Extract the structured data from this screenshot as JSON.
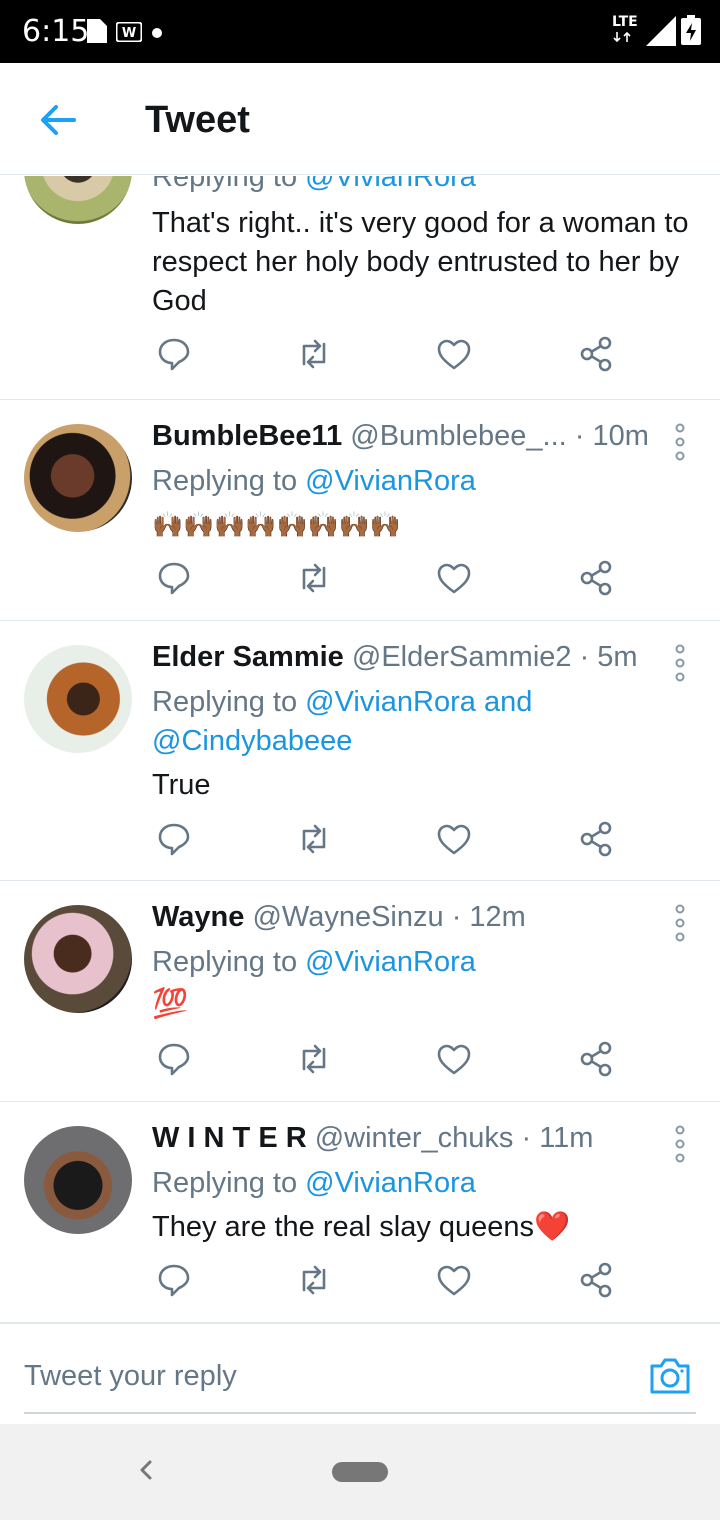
{
  "status": {
    "time": "6:15",
    "network": "LTE"
  },
  "header": {
    "title": "Tweet"
  },
  "tweets": [
    {
      "name": "",
      "handle": "",
      "time": "",
      "replying_prefix": "Replying to",
      "mentions": "@VivianRora",
      "mentions2": "",
      "text": "That's right.. it's very good for a woman to respect her holy body entrusted to her by God"
    },
    {
      "name": "BumbleBee11",
      "handle": "@Bumblebee_...",
      "time": "· 10m",
      "replying_prefix": "Replying to",
      "mentions": "@VivianRora",
      "mentions2": "",
      "text": "🙌🏾🙌🏾🙌🏾🙌🏾🙌🏾🙌🏾🙌🏾🙌🏾"
    },
    {
      "name": "Elder Sammie",
      "handle": "@ElderSammie2",
      "time": "· 5m",
      "replying_prefix": "Replying to",
      "mentions": "@VivianRora and",
      "mentions2": "@Cindybabeee",
      "text": "True"
    },
    {
      "name": "Wayne",
      "handle": "@WayneSinzu",
      "time": "· 12m",
      "replying_prefix": "Replying to",
      "mentions": "@VivianRora",
      "mentions2": "",
      "text": "💯"
    },
    {
      "name": "W I N T E R",
      "handle": "@winter_chuks",
      "time": "· 11m",
      "replying_prefix": "Replying to",
      "mentions": "@VivianRora",
      "mentions2": "",
      "text": "They are the real slay queens❤️"
    }
  ],
  "composer": {
    "placeholder": "Tweet your reply"
  },
  "colors": {
    "accent": "#1da1f2",
    "link": "#1b95e0",
    "secondary_text": "#657786",
    "icon": "#657786"
  },
  "icons": [
    "back-arrow-icon",
    "reply-icon",
    "retweet-icon",
    "like-icon",
    "share-icon",
    "more-icon",
    "camera-icon"
  ]
}
